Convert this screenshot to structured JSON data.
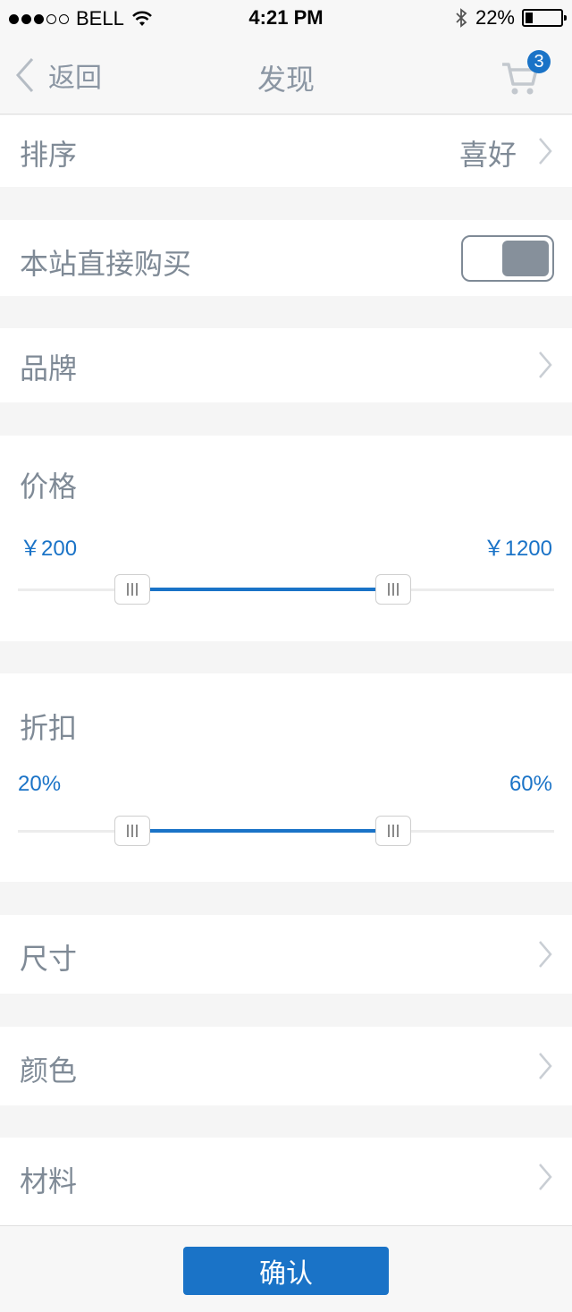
{
  "status_bar": {
    "carrier": "BELL",
    "time": "4:21 PM",
    "battery": "22%",
    "battery_level": 0.22,
    "signal_bars": 3,
    "icons": [
      "wifi-icon",
      "bluetooth-icon",
      "battery-icon"
    ]
  },
  "nav": {
    "back_label": "返回",
    "title": "发现",
    "cart_badge": "3"
  },
  "filters": {
    "sort": {
      "label": "排序",
      "value": "喜好"
    },
    "direct_buy": {
      "label": "本站直接购买",
      "on": true
    },
    "brand": {
      "label": "品牌"
    },
    "price": {
      "label": "价格",
      "min_text": "￥200",
      "max_text": "￥1200",
      "low": 200,
      "high": 1200
    },
    "discount": {
      "label": "折扣",
      "min_text": "20%",
      "max_text": "60%",
      "low": 20,
      "high": 60
    },
    "size": {
      "label": "尺寸"
    },
    "color": {
      "label": "颜色"
    },
    "material": {
      "label": "材料"
    }
  },
  "footer": {
    "confirm_label": "确认"
  },
  "colors": {
    "accent": "#1a73c7",
    "label_gray": "#7f8a96",
    "toggle_knob": "#86909b"
  }
}
